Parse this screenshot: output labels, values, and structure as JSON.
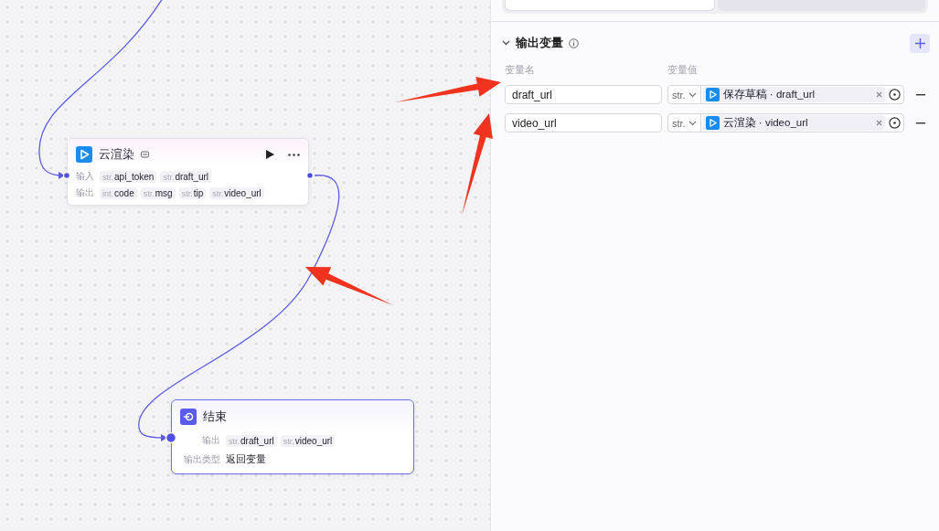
{
  "canvas": {
    "nodes": [
      {
        "kind": "tool",
        "title": "云渲染",
        "inputs_label": "输入",
        "inputs": [
          {
            "type": "str.",
            "name": "api_token"
          },
          {
            "type": "str.",
            "name": "draft_url"
          }
        ],
        "outputs_label": "输出",
        "outputs": [
          {
            "type": "int.",
            "name": "code"
          },
          {
            "type": "str.",
            "name": "msg"
          },
          {
            "type": "str.",
            "name": "tip"
          },
          {
            "type": "str.",
            "name": "video_url"
          }
        ]
      },
      {
        "kind": "end",
        "title": "结束",
        "outputs_label": "输出",
        "outputs": [
          {
            "type": "str.",
            "name": "draft_url"
          },
          {
            "type": "str.",
            "name": "video_url"
          }
        ],
        "output_type_label": "输出类型",
        "output_type": "返回变量"
      }
    ]
  },
  "panel": {
    "tabs": [
      {
        "selected": true
      },
      {
        "selected": false
      }
    ],
    "section": {
      "title": "输出变量",
      "expanded": true
    },
    "columns": [
      "变量名",
      "变量值"
    ],
    "rows": [
      {
        "name": "draft_url",
        "type": "str.",
        "reference": "保存草稿 · draft_url"
      },
      {
        "name": "video_url",
        "type": "str.",
        "reference": "云渲染 · video_url"
      }
    ]
  }
}
